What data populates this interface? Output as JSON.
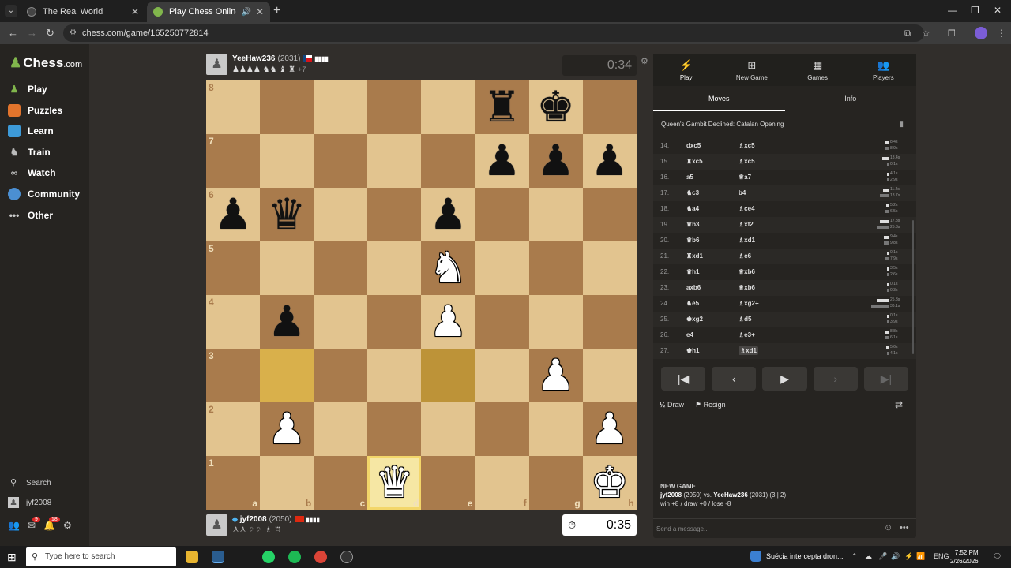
{
  "browser": {
    "tabs": [
      {
        "title": "The Real World"
      },
      {
        "title": "Play Chess Online for FREE"
      }
    ],
    "url": "chess.com/game/165250772814"
  },
  "sidebar": {
    "logo": "Chess",
    "logo_suffix": ".com",
    "items": [
      {
        "label": "Play"
      },
      {
        "label": "Puzzles"
      },
      {
        "label": "Learn"
      },
      {
        "label": "Train"
      },
      {
        "label": "Watch"
      },
      {
        "label": "Community"
      },
      {
        "label": "Other"
      }
    ],
    "search_label": "Search",
    "user": "jyf2008",
    "mail_badge": "9",
    "notif_badge": "18"
  },
  "top_player": {
    "name": "YeeHaw236",
    "rating": "(2031)",
    "captured": "♟♟♟♟ ♞♞ ♝ ♜",
    "advantage": "+7",
    "clock": "0:34"
  },
  "bottom_player": {
    "name": "jyf2008",
    "rating": "(2050)",
    "captured": "♙♙ ♘♘ ♗ ♖",
    "clock": "0:35"
  },
  "board": {
    "ranks": [
      "8",
      "7",
      "6",
      "5",
      "4",
      "3",
      "2",
      "1"
    ],
    "files": [
      "a",
      "b",
      "c",
      "d",
      "e",
      "f",
      "g",
      "h"
    ],
    "pieces": {
      "f8": "br",
      "g8": "bk",
      "f7": "bp",
      "g7": "bp",
      "h7": "bp",
      "a6": "bp",
      "b6": "bq",
      "e6": "bp",
      "e5": "wn",
      "b4": "bp",
      "e4": "wp",
      "g3": "wp",
      "b2": "wp",
      "h2": "wp",
      "d1": "wq",
      "h1": "wk"
    },
    "last_move": [
      "b3",
      "e3"
    ],
    "selected": "d1"
  },
  "panel": {
    "tabs": [
      {
        "label": "Play",
        "icon": "bolt-icon"
      },
      {
        "label": "New Game",
        "icon": "plus-icon"
      },
      {
        "label": "Games",
        "icon": "board-icon"
      },
      {
        "label": "Players",
        "icon": "players-icon"
      }
    ],
    "subtabs": [
      "Moves",
      "Info"
    ],
    "opening": "Queen's Gambit Declined: Catalan Opening",
    "moves": [
      {
        "n": "14.",
        "w": "dxc5",
        "b": "♗xc5",
        "wt": "8.4s",
        "bt": "8.9s"
      },
      {
        "n": "15.",
        "w": "♜xc5",
        "b": "♗xc5",
        "wt": "13.4s",
        "bt": "0.1s"
      },
      {
        "n": "16.",
        "w": "a5",
        "b": "♕a7",
        "wt": "4.1s",
        "bt": "2.9s"
      },
      {
        "n": "17.",
        "w": "♞c3",
        "b": "b4",
        "wt": "11.2s",
        "bt": "18.7s"
      },
      {
        "n": "18.",
        "w": "♞a4",
        "b": "♗ce4",
        "wt": "5.2s",
        "bt": "6.5s"
      },
      {
        "n": "19.",
        "w": "♛b3",
        "b": "♗xf2",
        "wt": "17.8s",
        "bt": "25.3s"
      },
      {
        "n": "20.",
        "w": "♛b6",
        "b": "♗xd1",
        "wt": "9.4s",
        "bt": "9.8s"
      },
      {
        "n": "21.",
        "w": "♜xd1",
        "b": "♗c6",
        "wt": "0.1s",
        "bt": "7.9s"
      },
      {
        "n": "22.",
        "w": "♛h1",
        "b": "♕xb6",
        "wt": "3.5s",
        "bt": "2.6s"
      },
      {
        "n": "23.",
        "w": "axb6",
        "b": "♕xb6",
        "wt": "0.1s",
        "bt": "0.3s"
      },
      {
        "n": "24.",
        "w": "♞e5",
        "b": "♗xg2+",
        "wt": "25.3s",
        "bt": "36.1s"
      },
      {
        "n": "25.",
        "w": "♚xg2",
        "b": "♗d5",
        "wt": "0.1s",
        "bt": "3.9s"
      },
      {
        "n": "26.",
        "w": "e4",
        "b": "♗e3+",
        "wt": "8.8s",
        "bt": "6.1s"
      },
      {
        "n": "27.",
        "w": "♚h1",
        "b": "♗xd1",
        "wt": "5.6s",
        "bt": "4.1s"
      }
    ],
    "actions": {
      "draw": "Draw",
      "resign": "Resign"
    },
    "new_game": {
      "heading": "NEW GAME",
      "line1_p1": "jyf2008",
      "line1_p1r": "(2050) vs.",
      "line1_p2": "YeeHaw236",
      "line1_p2r": "(2031) (3 | 2)",
      "line2": "win +8 / draw +0 / lose -8"
    },
    "chat_placeholder": "Send a message..."
  },
  "taskbar": {
    "search_placeholder": "Type here to search",
    "news": "Suécia intercepta dron...",
    "lang": "ENG",
    "time": "7:52 PM",
    "date": "2/26/2026"
  },
  "colors": {
    "light_square": "#e2c48f",
    "dark_square": "#a97b4c",
    "highlight": "#d9b04b",
    "accent_green": "#81b64c"
  }
}
